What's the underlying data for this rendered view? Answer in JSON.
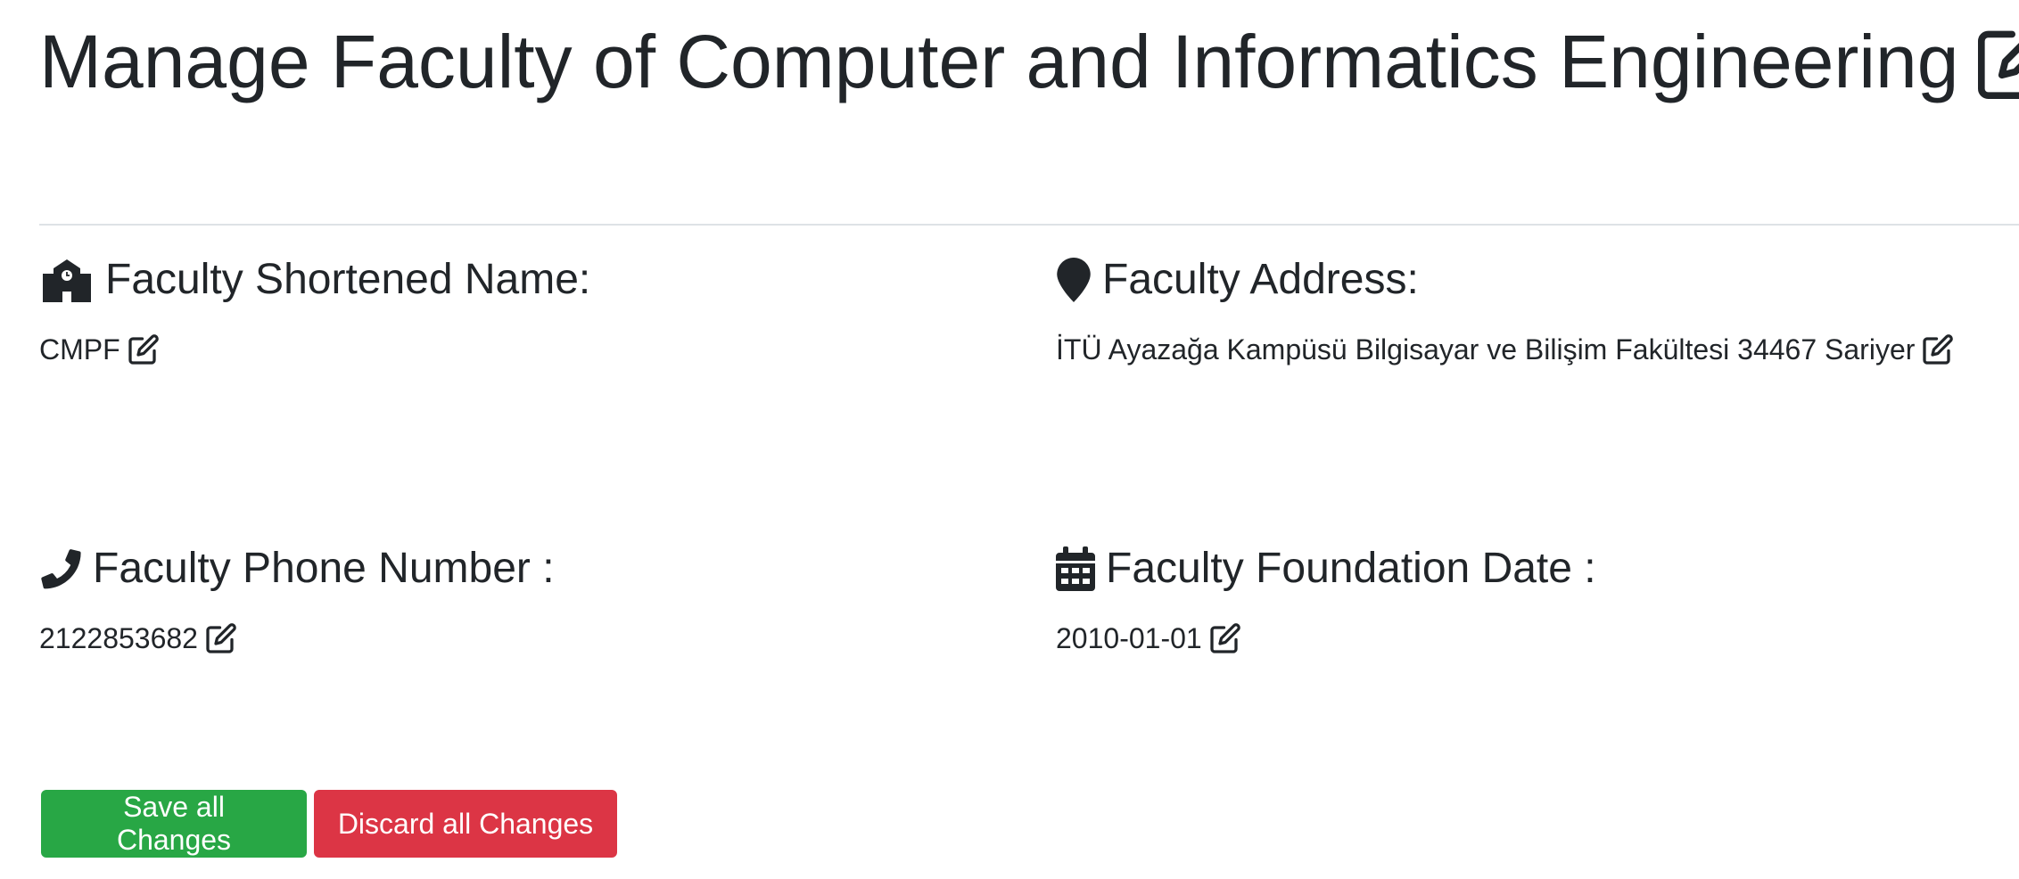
{
  "header": {
    "title": "Manage Faculty of Computer and Informatics Engineering",
    "edit_icon": "edit-icon"
  },
  "fields": {
    "short_name": {
      "label": "Faculty Shortened Name:",
      "value": "CMPF",
      "icon": "school-icon"
    },
    "address": {
      "label": "Faculty Address:",
      "value": "İTÜ Ayazağa Kampüsü Bilgisayar ve Bilişim Fakültesi 34467 Sariyer",
      "icon": "map-marker-icon"
    },
    "phone": {
      "label": "Faculty Phone Number :",
      "value": "2122853682",
      "icon": "phone-icon"
    },
    "foundation_date": {
      "label": "Faculty Foundation Date :",
      "value": "2010-01-01",
      "icon": "calendar-icon"
    }
  },
  "actions": {
    "save_label": "Save all Changes",
    "discard_label": "Discard all Changes"
  },
  "colors": {
    "text": "#212529",
    "save_button": "#28a745",
    "discard_button": "#dc3545",
    "divider": "#dee2e6"
  }
}
